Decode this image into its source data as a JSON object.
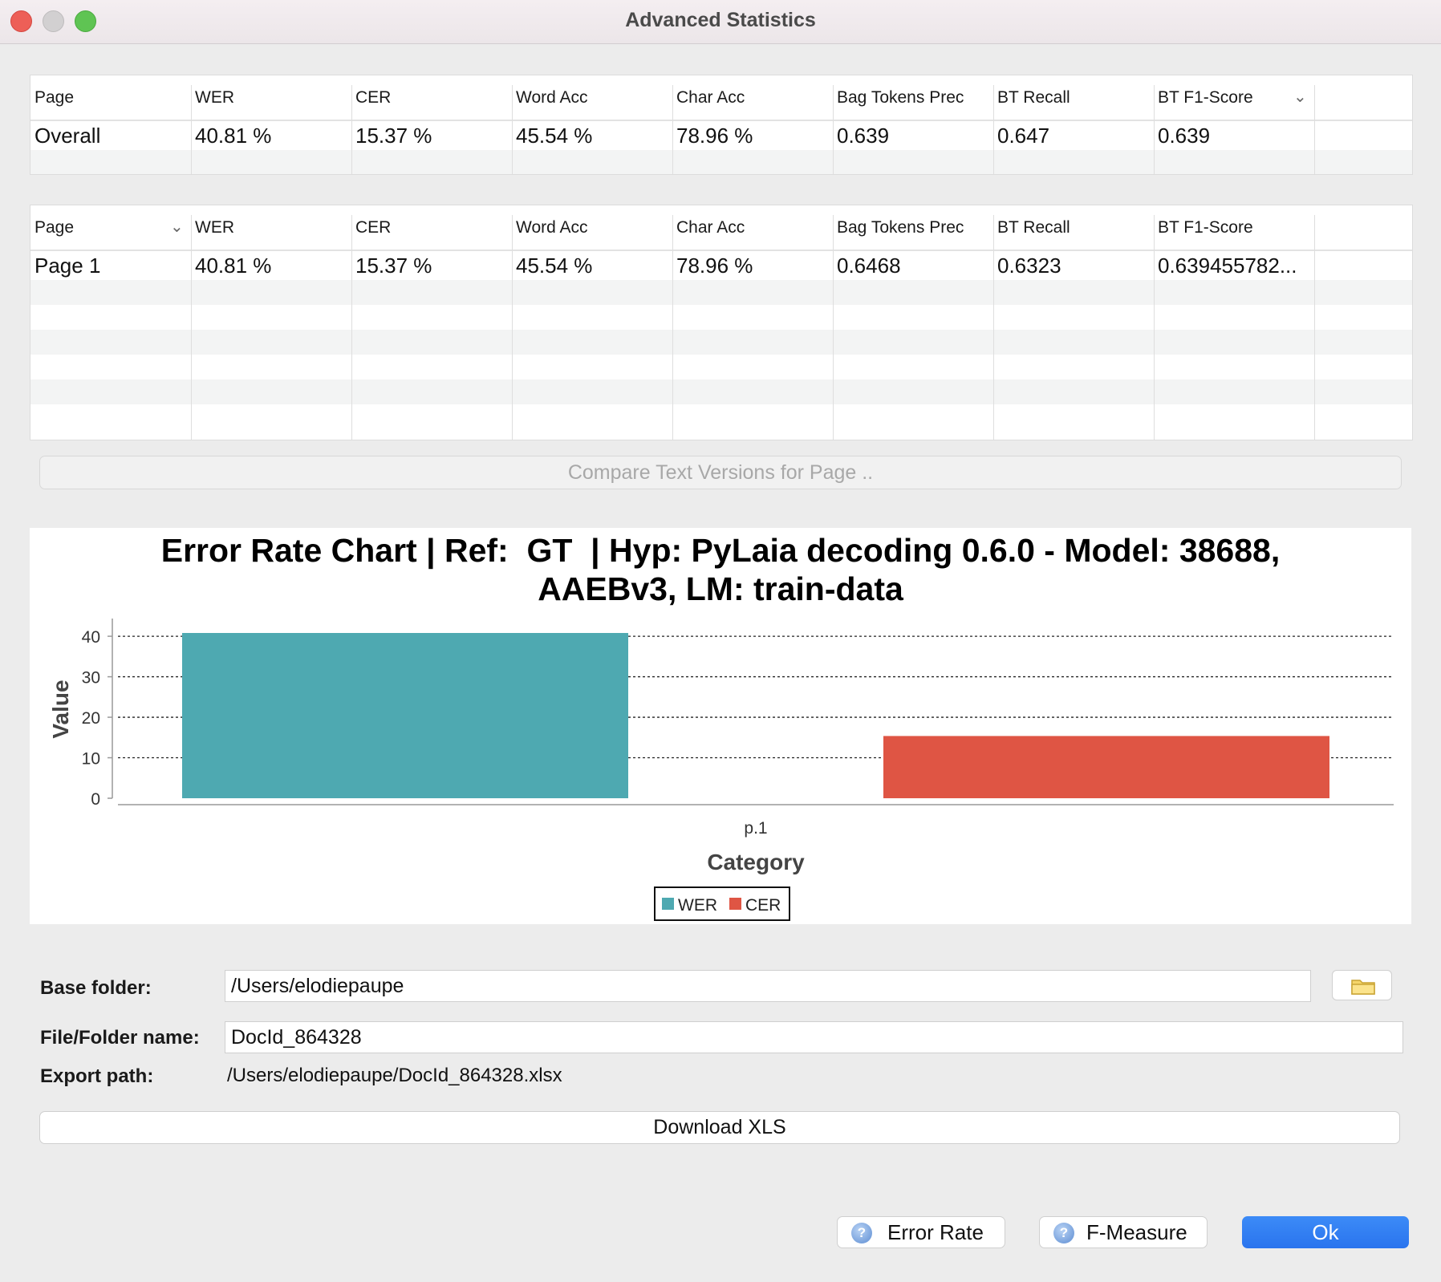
{
  "window": {
    "title": "Advanced Statistics"
  },
  "overall_table": {
    "columns": [
      "Page",
      "WER",
      "CER",
      "Word Acc",
      "Char Acc",
      "Bag Tokens Prec",
      "BT Recall",
      "BT F1-Score"
    ],
    "rows": [
      [
        "Overall",
        "40.81 %",
        "15.37 %",
        "45.54 %",
        "78.96 %",
        "0.639",
        "0.647",
        "0.639"
      ]
    ]
  },
  "page_table": {
    "columns": [
      "Page",
      "WER",
      "CER",
      "Word Acc",
      "Char Acc",
      "Bag Tokens Prec",
      "BT Recall",
      "BT F1-Score"
    ],
    "rows": [
      [
        "Page 1",
        "40.81 %",
        "15.37 %",
        "45.54 %",
        "78.96 %",
        "0.6468",
        "0.6323",
        "0.639455782..."
      ]
    ]
  },
  "compare_button": {
    "label": "Compare Text Versions for Page .."
  },
  "chart_data": {
    "type": "bar",
    "title_line1": "Error Rate Chart | Ref:  GT  | Hyp: PyLaia decoding 0.6.0 - Model: 38688,",
    "title_line2": "AAEBv3, LM: train-data",
    "xlabel": "Category",
    "ylabel": "Value",
    "categories": [
      "p.1"
    ],
    "series": [
      {
        "name": "WER",
        "values": [
          40.81
        ],
        "color": "#4ea9b1"
      },
      {
        "name": "CER",
        "values": [
          15.37
        ],
        "color": "#df5544"
      }
    ],
    "ylim": [
      0,
      40.81
    ],
    "yticks": [
      0,
      10,
      20,
      30,
      40
    ],
    "grid": true,
    "legend_position": "bottom"
  },
  "export": {
    "base_folder_label": "Base folder:",
    "base_folder_value": "/Users/elodiepaupe",
    "name_label": "File/Folder name:",
    "name_value": "DocId_864328",
    "path_label": "Export path:",
    "path_value": "/Users/elodiepaupe/DocId_864328.xlsx",
    "download_label": "Download XLS",
    "folder_icon": "folder-icon"
  },
  "footer": {
    "error_rate_label": "Error Rate",
    "f_measure_label": "F-Measure",
    "ok_label": "Ok",
    "help_icon": "help-icon",
    "ok_color": "#2f7ff2"
  }
}
